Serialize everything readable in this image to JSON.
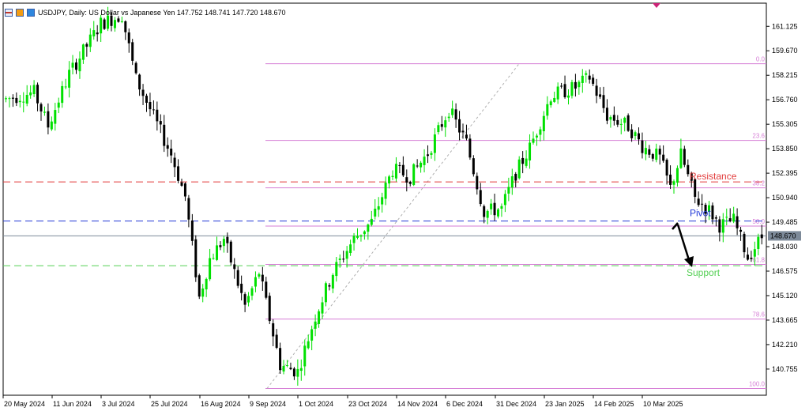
{
  "header": {
    "symbol_line": "USDJPY, Daily:  US Dollar vs Japanese Yen  147.752 148.741 147.720 148.670"
  },
  "price_tag": "148.670",
  "chart_data": {
    "type": "candlestick",
    "symbol": "USDJPY",
    "timeframe": "Daily",
    "ohlc_current": {
      "open": 147.752,
      "high": 148.741,
      "low": 147.72,
      "close": 148.67
    },
    "ylim": [
      139.2,
      162.5
    ],
    "y_ticks": [
      "161.125",
      "159.670",
      "158.215",
      "156.760",
      "155.305",
      "153.850",
      "152.395",
      "150.940",
      "149.485",
      "148.030",
      "146.575",
      "145.120",
      "143.665",
      "142.210",
      "140.755"
    ],
    "x_labels": [
      "20 May 2024",
      "11 Jun 2024",
      "3 Jul 2024",
      "25 Jul 2024",
      "16 Aug 2024",
      "9 Sep 2024",
      "1 Oct 2024",
      "23 Oct 2024",
      "14 Nov 2024",
      "6 Dec 2024",
      "31 Dec 2024",
      "23 Jan 2025",
      "14 Feb 2025",
      "10 Mar 2025"
    ],
    "path_points": [
      {
        "i": 0,
        "p": 156.8
      },
      {
        "i": 8,
        "p": 157.2
      },
      {
        "i": 12,
        "p": 155.2
      },
      {
        "i": 18,
        "p": 158.3
      },
      {
        "i": 27,
        "p": 161.3
      },
      {
        "i": 33,
        "p": 161.8
      },
      {
        "i": 37,
        "p": 158.0
      },
      {
        "i": 47,
        "p": 153.5
      },
      {
        "i": 51,
        "p": 151.0
      },
      {
        "i": 55,
        "p": 145.0
      },
      {
        "i": 58,
        "p": 147.3
      },
      {
        "i": 62,
        "p": 148.5
      },
      {
        "i": 68,
        "p": 144.5
      },
      {
        "i": 72,
        "p": 146.5
      },
      {
        "i": 78,
        "p": 141.0
      },
      {
        "i": 83,
        "p": 140.6
      },
      {
        "i": 88,
        "p": 143.9
      },
      {
        "i": 93,
        "p": 146.5
      },
      {
        "i": 99,
        "p": 148.5
      },
      {
        "i": 104,
        "p": 149.5
      },
      {
        "i": 110,
        "p": 152.6
      },
      {
        "i": 115,
        "p": 152.2
      },
      {
        "i": 120,
        "p": 153.6
      },
      {
        "i": 126,
        "p": 156.2
      },
      {
        "i": 131,
        "p": 154.2
      },
      {
        "i": 136,
        "p": 150.1
      },
      {
        "i": 141,
        "p": 150.3
      },
      {
        "i": 145,
        "p": 152.4
      },
      {
        "i": 149,
        "p": 153.9
      },
      {
        "i": 155,
        "p": 157.0
      },
      {
        "i": 162,
        "p": 157.5
      },
      {
        "i": 166,
        "p": 158.1
      },
      {
        "i": 171,
        "p": 155.8
      },
      {
        "i": 177,
        "p": 155.2
      },
      {
        "i": 181,
        "p": 154.0
      },
      {
        "i": 186,
        "p": 153.3
      },
      {
        "i": 189,
        "p": 151.5
      },
      {
        "i": 192,
        "p": 153.5
      },
      {
        "i": 196,
        "p": 150.9
      },
      {
        "i": 200,
        "p": 150.2
      },
      {
        "i": 203,
        "p": 149.3
      },
      {
        "i": 207,
        "p": 149.6
      },
      {
        "i": 211,
        "p": 147.4
      },
      {
        "i": 215,
        "p": 148.6
      }
    ],
    "fibonacci": {
      "high": 158.9,
      "low": 139.6,
      "levels": [
        {
          "label": "0.0",
          "ratio": 0.0
        },
        {
          "label": "23.6",
          "ratio": 0.236
        },
        {
          "label": "38.2",
          "ratio": 0.382
        },
        {
          "label": "50.0",
          "ratio": 0.5
        },
        {
          "label": "61.8",
          "ratio": 0.618
        },
        {
          "label": "78.6",
          "ratio": 0.786
        },
        {
          "label": "100.0",
          "ratio": 1.0
        }
      ],
      "color": "#d67ed6"
    },
    "horizontal_lines": [
      {
        "name": "Resistance",
        "price": 151.88,
        "color": "#e23b3b",
        "style": "dashed"
      },
      {
        "name": "Pivot",
        "price": 149.55,
        "color": "#2238d8",
        "style": "dashed"
      },
      {
        "name": "Support",
        "price": 146.9,
        "color": "#55d055",
        "style": "dashed"
      }
    ],
    "annotations": [
      {
        "text": "Resistance",
        "color": "#e23b3b"
      },
      {
        "text": "Pivot",
        "color": "#2238d8"
      },
      {
        "text": "Support",
        "color": "#55d055"
      }
    ],
    "current_price_line": {
      "price": 148.67,
      "color": "#7d8a99"
    },
    "colors": {
      "bull": "#00e000",
      "bear": "#000000",
      "grid": "#ffffff",
      "axis": "#000000"
    }
  }
}
